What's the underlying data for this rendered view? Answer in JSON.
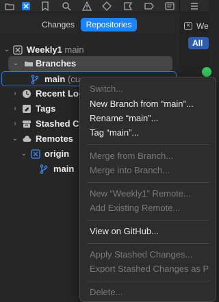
{
  "toolbar": {
    "icons": [
      "blue-square-icon",
      "bookmark-icon",
      "search-icon",
      "warning-icon",
      "diamond-icon",
      "tag-icon",
      "message-icon",
      "list-icon"
    ]
  },
  "segmented": {
    "changes": "Changes",
    "repositories": "Repositories"
  },
  "right_pane": {
    "tab_label": "Wee",
    "filter_all": "All"
  },
  "tree": {
    "repo_name": "Weekly1",
    "repo_branch": "main",
    "branches": "Branches",
    "main_branch": "main",
    "main_suffix": "(cu",
    "recent_locations": "Recent Loc",
    "tags": "Tags",
    "stashed": "Stashed C",
    "remotes": "Remotes",
    "origin": "origin",
    "origin_main": "main"
  },
  "context_menu": {
    "switch": "Switch...",
    "new_branch": "New Branch from “main”...",
    "rename": "Rename “main”...",
    "tag": "Tag “main”...",
    "merge_from": "Merge from Branch...",
    "merge_into": "Merge into Branch...",
    "new_remote": "New “Weekly1” Remote...",
    "add_remote": "Add Existing Remote...",
    "view_github": "View on GitHub...",
    "apply_stashed": "Apply Stashed Changes...",
    "export_stashed": "Export Stashed Changes as P",
    "delete": "Delete..."
  },
  "colors": {
    "accent": "#1a84ff",
    "selection_border": "#2f7de1",
    "branch_icon": "#3b8cf5",
    "status_green": "#34c759"
  }
}
